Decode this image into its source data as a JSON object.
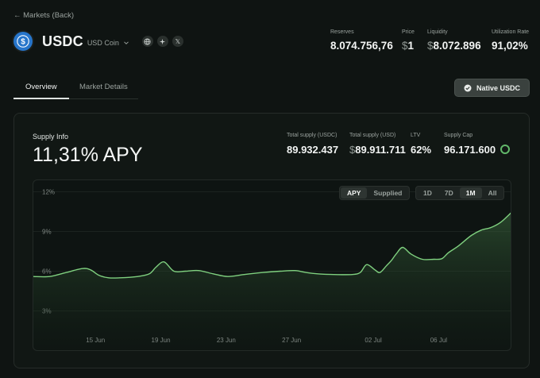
{
  "nav": {
    "back_label": "← Markets (Back)"
  },
  "asset": {
    "symbol": "USDC",
    "name": "USD Coin",
    "links": [
      {
        "icon": "globe-icon"
      },
      {
        "icon": "explorer-icon"
      },
      {
        "icon": "x-icon",
        "glyph": "𝕏"
      }
    ]
  },
  "top_stats": [
    {
      "label": "Reserves",
      "prefix": "",
      "value": "8.074.756,76"
    },
    {
      "label": "Price",
      "prefix": "$",
      "value": "1"
    },
    {
      "label": "Liquidity",
      "prefix": "$",
      "value": "8.072.896"
    },
    {
      "label": "Utilization Rate",
      "prefix": "",
      "value": "91,02%"
    }
  ],
  "tabs": [
    {
      "label": "Overview",
      "active": true
    },
    {
      "label": "Market Details",
      "active": false
    }
  ],
  "native_button": {
    "label": "Native USDC"
  },
  "supply": {
    "title": "Supply Info",
    "apy": "11,31% APY",
    "stats": [
      {
        "label": "Total supply (USDC)",
        "prefix": "",
        "value": "89.932.437"
      },
      {
        "label": "Total supply (USD)",
        "prefix": "$",
        "value": "89.911.711"
      },
      {
        "label": "LTV",
        "prefix": "",
        "value": "62%"
      },
      {
        "label": "Supply Cap",
        "prefix": "",
        "value": "96.171.600"
      }
    ]
  },
  "metric_toggle": [
    "APY",
    "Supplied"
  ],
  "metric_active": "APY",
  "range_toggle": [
    "1D",
    "7D",
    "1M",
    "All"
  ],
  "range_active": "1M",
  "colors": {
    "accent": "#62b86a",
    "line": "#7fd07f",
    "background": "#0f1412"
  },
  "chart_data": {
    "type": "area",
    "y_ticks": [
      "12%",
      "9%",
      "6%",
      "3%"
    ],
    "ylim": [
      0,
      12
    ],
    "x_ticks": [
      {
        "label": "15 Jun",
        "x": 15
      },
      {
        "label": "19 Jun",
        "x": 19
      },
      {
        "label": "23 Jun",
        "x": 23
      },
      {
        "label": "27 Jun",
        "x": 27
      },
      {
        "label": "02 Jul",
        "x": 32
      },
      {
        "label": "06 Jul",
        "x": 36
      }
    ],
    "xlim": [
      11.2,
      40.5
    ],
    "series": [
      {
        "x": [
          11.2,
          12.2,
          13.2,
          14.2,
          14.7,
          15.2,
          15.8,
          16.5,
          17.6,
          18.3,
          18.7,
          19.2,
          19.8,
          20.5,
          21.3,
          22.2,
          23.1,
          24.1,
          25.2,
          26.3,
          27.2,
          27.9,
          28.6,
          29.6,
          30.7,
          31.2,
          31.6,
          32.1,
          32.4,
          32.8,
          33.1,
          33.4,
          33.8,
          34.3,
          35.0,
          35.7,
          36.2,
          36.6,
          37.2,
          38.0,
          38.6,
          39.2,
          39.8,
          40.5
        ],
        "y": [
          5.6,
          5.6,
          5.9,
          6.2,
          6.1,
          5.7,
          5.5,
          5.5,
          5.6,
          5.8,
          6.3,
          6.7,
          6.0,
          6.0,
          6.05,
          5.8,
          5.6,
          5.75,
          5.9,
          6.0,
          6.05,
          5.9,
          5.8,
          5.75,
          5.75,
          5.9,
          6.5,
          6.1,
          5.9,
          6.4,
          6.8,
          7.3,
          7.8,
          7.3,
          6.9,
          6.9,
          6.95,
          7.4,
          7.9,
          8.7,
          9.1,
          9.3,
          9.7,
          10.5
        ]
      }
    ]
  }
}
